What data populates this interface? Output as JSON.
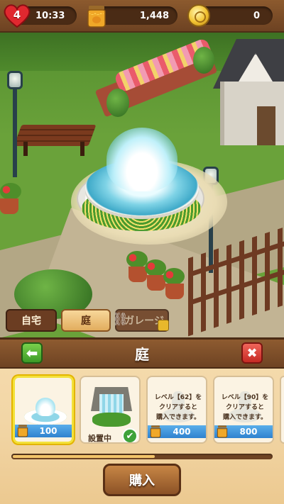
{
  "hud": {
    "lives": "4",
    "timer": "10:33",
    "honey": "1,448",
    "coins": "0"
  },
  "tabs": [
    {
      "label": "自宅",
      "active": false,
      "locked": false
    },
    {
      "label": "庭",
      "active": true,
      "locked": false
    },
    {
      "label": "ガレージ",
      "active": false,
      "locked": true
    }
  ],
  "panel": {
    "title": "庭",
    "items": [
      {
        "kind": "fountain",
        "price": "100",
        "selected": true
      },
      {
        "kind": "waterfall",
        "status": "設置中"
      },
      {
        "kind": "locked-fountain",
        "desc": "レベル【62】を\nクリアすると\n購入できます。",
        "price": "400"
      },
      {
        "kind": "locked-fountain",
        "desc": "レベル【90】を\nクリアすると\n購入できます。",
        "price": "800"
      }
    ],
    "buy_label": "購入",
    "scroll_progress": 0.55
  },
  "colors": {
    "hud_wood": "#8c5a2e",
    "panel_bg": "#f6dcae",
    "price_blue": "#2f82cf",
    "select_yellow": "#f3e13a",
    "back_green": "#3c9a27",
    "close_red": "#c52a24"
  },
  "icons": {
    "lives": "heart-icon",
    "honey": "honey-jar-icon",
    "coins": "coin-icon",
    "back": "arrow-left-icon",
    "close": "close-icon",
    "installed": "check-icon",
    "locked": "lock-icon",
    "chain": "chain-icon"
  }
}
